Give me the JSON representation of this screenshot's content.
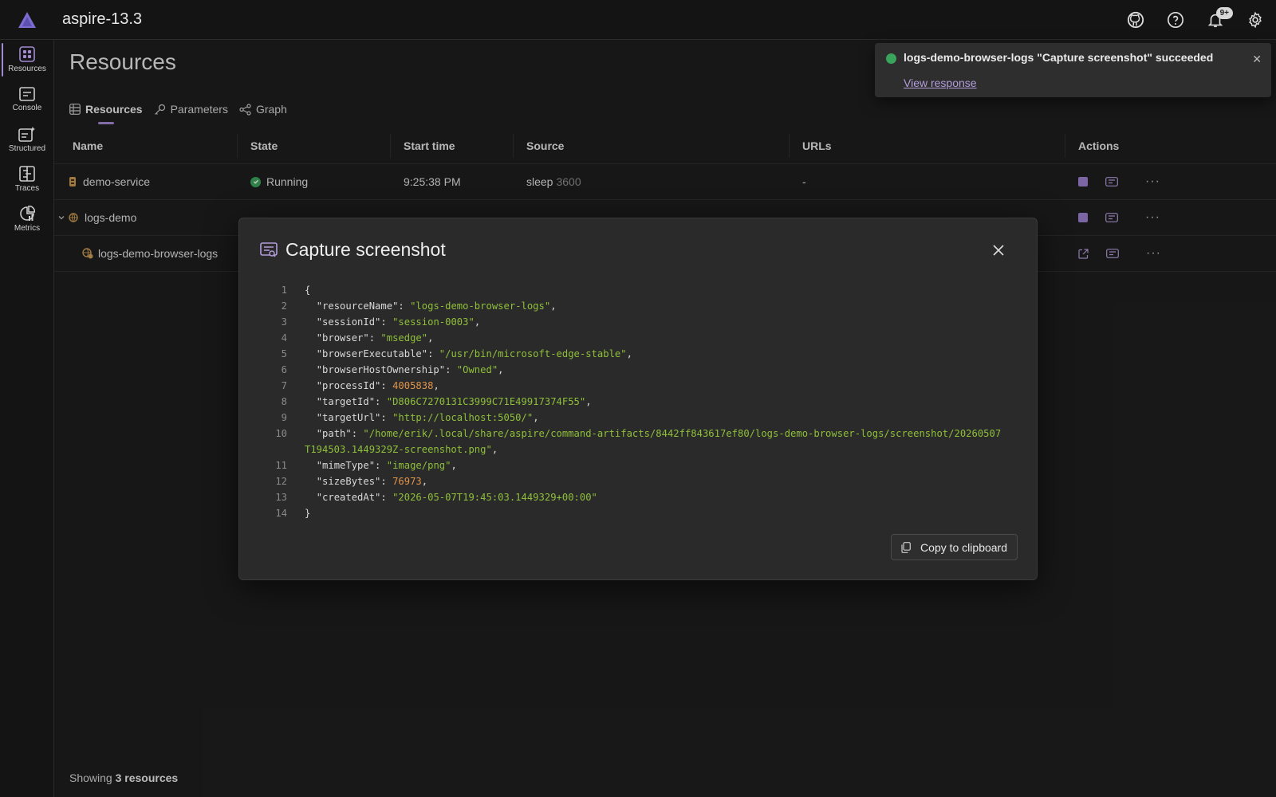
{
  "app": {
    "title": "aspire-13.3",
    "notification_count": "9+"
  },
  "sidenav": [
    {
      "label": "Resources",
      "icon": "resources-icon",
      "active": true
    },
    {
      "label": "Console",
      "icon": "console-icon"
    },
    {
      "label": "Structured",
      "icon": "structured-icon"
    },
    {
      "label": "Traces",
      "icon": "traces-icon"
    },
    {
      "label": "Metrics",
      "icon": "metrics-icon"
    }
  ],
  "page": {
    "title": "Resources",
    "tabs": [
      {
        "label": "Resources",
        "icon": "grid-icon",
        "active": true
      },
      {
        "label": "Parameters",
        "icon": "key-icon"
      },
      {
        "label": "Graph",
        "icon": "share-icon"
      }
    ],
    "columns": [
      "Name",
      "State",
      "Start time",
      "Source",
      "URLs",
      "Actions"
    ],
    "rows": [
      {
        "name": "demo-service",
        "state": "Running",
        "start": "9:25:38 PM",
        "source": "sleep",
        "source_arg": "3600",
        "urls": "-"
      },
      {
        "name": "logs-demo",
        "state": "",
        "start": "",
        "source": "",
        "source_arg": "",
        "urls": ""
      },
      {
        "name": "logs-demo-browser-logs",
        "state": "",
        "start": "",
        "source": "",
        "source_arg": "",
        "urls": ""
      }
    ],
    "footer_prefix": "Showing",
    "footer_count": "3 resources"
  },
  "toast": {
    "message": "logs-demo-browser-logs \"Capture screenshot\" succeeded",
    "link": "View response",
    "status_color": "#3aa35c"
  },
  "dialog": {
    "title": "Capture screenshot",
    "copy_label": "Copy to clipboard",
    "lines": [
      {
        "n": "1",
        "parts": [
          [
            "p",
            "{"
          ]
        ]
      },
      {
        "n": "2",
        "parts": [
          [
            "k",
            "  \"resourceName\": "
          ],
          [
            "s",
            "\"logs-demo-browser-logs\""
          ],
          [
            "k",
            ","
          ]
        ]
      },
      {
        "n": "3",
        "parts": [
          [
            "k",
            "  \"sessionId\": "
          ],
          [
            "s",
            "\"session-0003\""
          ],
          [
            "k",
            ","
          ]
        ]
      },
      {
        "n": "4",
        "parts": [
          [
            "k",
            "  \"browser\": "
          ],
          [
            "s",
            "\"msedge\""
          ],
          [
            "k",
            ","
          ]
        ]
      },
      {
        "n": "5",
        "parts": [
          [
            "k",
            "  \"browserExecutable\": "
          ],
          [
            "s",
            "\"/usr/bin/microsoft-edge-stable\""
          ],
          [
            "k",
            ","
          ]
        ]
      },
      {
        "n": "6",
        "parts": [
          [
            "k",
            "  \"browserHostOwnership\": "
          ],
          [
            "s",
            "\"Owned\""
          ],
          [
            "k",
            ","
          ]
        ]
      },
      {
        "n": "7",
        "parts": [
          [
            "k",
            "  \"processId\": "
          ],
          [
            "n",
            "4005838"
          ],
          [
            "k",
            ","
          ]
        ]
      },
      {
        "n": "8",
        "parts": [
          [
            "k",
            "  \"targetId\": "
          ],
          [
            "s",
            "\"D806C7270131C3999C71E49917374F55\""
          ],
          [
            "k",
            ","
          ]
        ]
      },
      {
        "n": "9",
        "parts": [
          [
            "k",
            "  \"targetUrl\": "
          ],
          [
            "s",
            "\"http://localhost:5050/\""
          ],
          [
            "k",
            ","
          ]
        ]
      },
      {
        "n": "10",
        "parts": [
          [
            "k",
            "  \"path\": "
          ],
          [
            "s",
            "\"/home/erik/.local/share/aspire/command-artifacts/8442ff843617ef80/logs-demo-browser-logs/screenshot/20260507T194503.1449329Z-screenshot.png\""
          ],
          [
            "k",
            ","
          ]
        ]
      },
      {
        "n": "11",
        "parts": [
          [
            "k",
            "  \"mimeType\": "
          ],
          [
            "s",
            "\"image/png\""
          ],
          [
            "k",
            ","
          ]
        ]
      },
      {
        "n": "12",
        "parts": [
          [
            "k",
            "  \"sizeBytes\": "
          ],
          [
            "n",
            "76973"
          ],
          [
            "k",
            ","
          ]
        ]
      },
      {
        "n": "13",
        "parts": [
          [
            "k",
            "  \"createdAt\": "
          ],
          [
            "s",
            "\"2026-05-07T19:45:03.1449329+00:00\""
          ]
        ]
      },
      {
        "n": "14",
        "parts": [
          [
            "p",
            "}"
          ]
        ]
      }
    ]
  },
  "colors": {
    "accent": "#a48ad3",
    "running": "#3aa35c",
    "string": "#8fbf3a",
    "number": "#e0944a"
  }
}
